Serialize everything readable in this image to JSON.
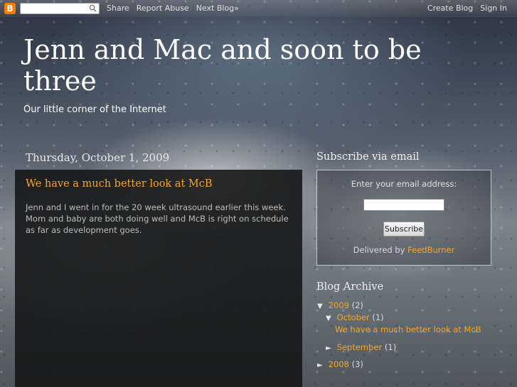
{
  "navbar": {
    "logo_letter": "B",
    "search_placeholder": "",
    "share": "Share",
    "report_abuse": "Report Abuse",
    "next_blog": "Next Blog»",
    "create_blog": "Create Blog",
    "sign_in": "Sign In"
  },
  "header": {
    "title": "Jenn and Mac and soon to be three",
    "description": "Our little corner of the Internet"
  },
  "main": {
    "date": "Thursday, October 1, 2009",
    "post": {
      "title": "We have a much better look at McB",
      "body": "Jenn and I went in for the 20 week ultrasound earlier this week. Mom and baby are both doing well and McB is right on schedule as far as development goes."
    }
  },
  "sidebar": {
    "subscribe": {
      "heading": "Subscribe via email",
      "label": "Enter your email address:",
      "button": "Subscribe",
      "delivered_by": "Delivered by",
      "provider": "FeedBurner"
    },
    "archive": {
      "heading": "Blog Archive",
      "expanded_glyph": "▼",
      "collapsed_glyph": "►",
      "years": [
        {
          "label": "2009",
          "count": "(2)",
          "months": [
            {
              "label": "October",
              "count": "(1)",
              "posts": [
                "We have a much better look at McB"
              ]
            },
            {
              "label": "September",
              "count": "(1)"
            }
          ]
        },
        {
          "label": "2008",
          "count": "(3)"
        }
      ]
    }
  },
  "colors": {
    "accent": "#f5a623",
    "post_bg": "#141414",
    "text": "#bdbdbd"
  }
}
